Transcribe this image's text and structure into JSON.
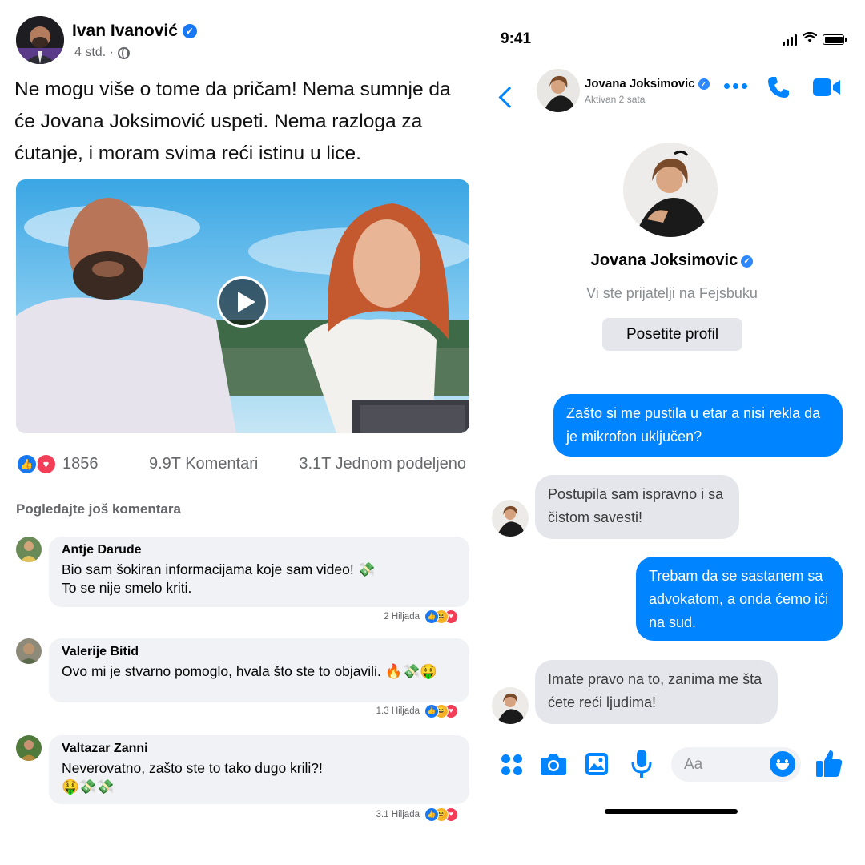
{
  "post": {
    "author": "Ivan Ivanović",
    "time": "4 std. ·",
    "text": "Ne mogu više o tome da pričam! Nema sumnje da će Jovana Joksimović uspeti. Nema razloga za ćutanje, i moram svima reći istinu u lice.",
    "reactions_count": "1856",
    "comments_count": "9.9T Komentari",
    "shares_count": "3.1T Jednom podeljeno",
    "more_comments": "Pogledajte još komentara"
  },
  "comments": [
    {
      "name": "Antje Darude",
      "line1": "Bio sam šokiran informacijama koje sam video! 💸",
      "line2": "To se nije smelo kriti.",
      "likes": "2 Hiljada"
    },
    {
      "name": "Valerije Bitid",
      "line1": "Ovo mi je stvarno pomoglo, hvala što ste to objavili. 🔥💸🤑",
      "line2": "",
      "likes": "1.3 Hiljada"
    },
    {
      "name": "Valtazar Zanni",
      "line1": "Neverovatno, zašto ste to tako dugo krili?!",
      "line2": "🤑💸💸",
      "likes": "3.1 Hiljada"
    }
  ],
  "messenger": {
    "time": "9:41",
    "contact_name": "Jovana Joksimovic",
    "contact_status": "Aktivan 2 sata",
    "profile_name": "Jovana Joksimovic",
    "friends_info": "Vi ste prijatelji na Fejsbuku",
    "visit_profile": "Posetite profil",
    "messages": [
      {
        "from": "me",
        "text": "Zašto si me pustila u etar a nisi rekla da je mikrofon uključen?"
      },
      {
        "from": "them",
        "text": "Postupila sam ispravno i sa čistom savesti!"
      },
      {
        "from": "me",
        "text": "Trebam da se sastanem sa advokatom, a onda ćemo ići na sud."
      },
      {
        "from": "them",
        "text": "Imate pravo na to, zanima me šta ćete reći ljudima!"
      }
    ],
    "composer_placeholder": "Aa"
  },
  "icons": [
    "verified-icon",
    "globe-icon",
    "play-icon",
    "like-reaction-icon",
    "love-reaction-icon",
    "back-icon",
    "more-icon",
    "phone-icon",
    "video-call-icon",
    "apps-icon",
    "camera-icon",
    "gallery-icon",
    "microphone-icon",
    "emoji-icon",
    "thumbs-up-icon"
  ],
  "colors": {
    "facebook_blue": "#1877f2",
    "messenger_blue": "#0084ff",
    "bubble_gray": "#e4e6eb",
    "comment_gray": "#f0f2f5",
    "love_red": "#f33e58"
  }
}
